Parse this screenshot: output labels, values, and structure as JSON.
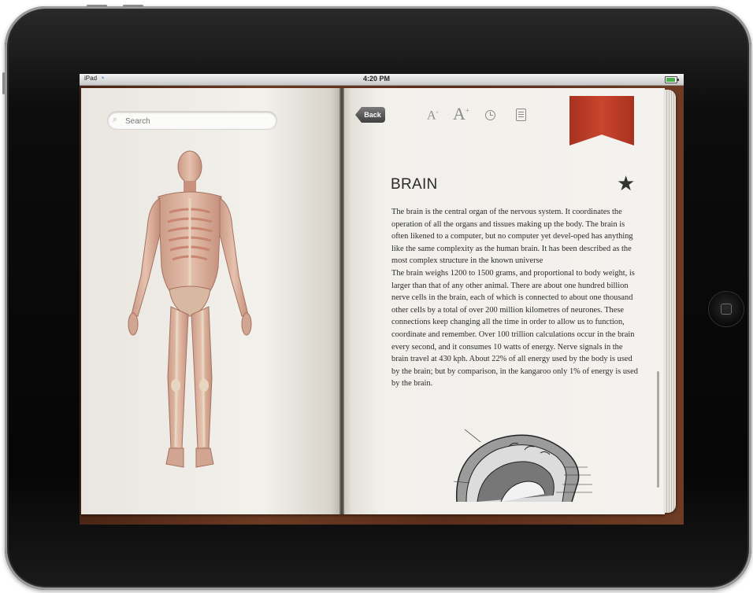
{
  "status_bar": {
    "carrier": "iPad",
    "time": "4:20 PM",
    "battery_level": 0.9
  },
  "search": {
    "placeholder": "Search"
  },
  "toolbar": {
    "back_label": "Back",
    "decrease_font_label": "A",
    "decrease_font_sup": "-",
    "increase_font_label": "A",
    "increase_font_sup": "+",
    "icons": [
      "clock-icon",
      "notes-icon",
      "bookmark-ribbon-icon",
      "star-icon"
    ]
  },
  "article": {
    "title": "BRAIN",
    "paragraphs": [
      "The brain is the central organ of the nervous system. It coordinates the operation of all the organs and tissues making up the body. The brain is often likened to a computer, but no computer yet devel-oped has anything like the same complexity as the human brain. It has been described as the most complex structure in the known universe",
      "The brain weighs 1200 to 1500 grams, and proportional to body weight, is larger than that of any other animal. There are about one hundred billion nerve cells in the brain, each of which is connected to about one thousand other cells by a total of over 200 million kilometres of neurones. These connections keep changing all the time in order to allow us to function, coordinate and remember. Over 100 trillion calculations occur in the brain every second, and it consumes 10 watts of energy. Nerve signals in the brain travel at 430 kph. About 22% of all energy used by the body is used by the brain; but by comparison, in the kangaroo only 1% of energy is used by the brain."
    ]
  },
  "colors": {
    "ribbon": "#b83a24",
    "wood": "#5a2e1a",
    "page": "#f2f0eb"
  }
}
